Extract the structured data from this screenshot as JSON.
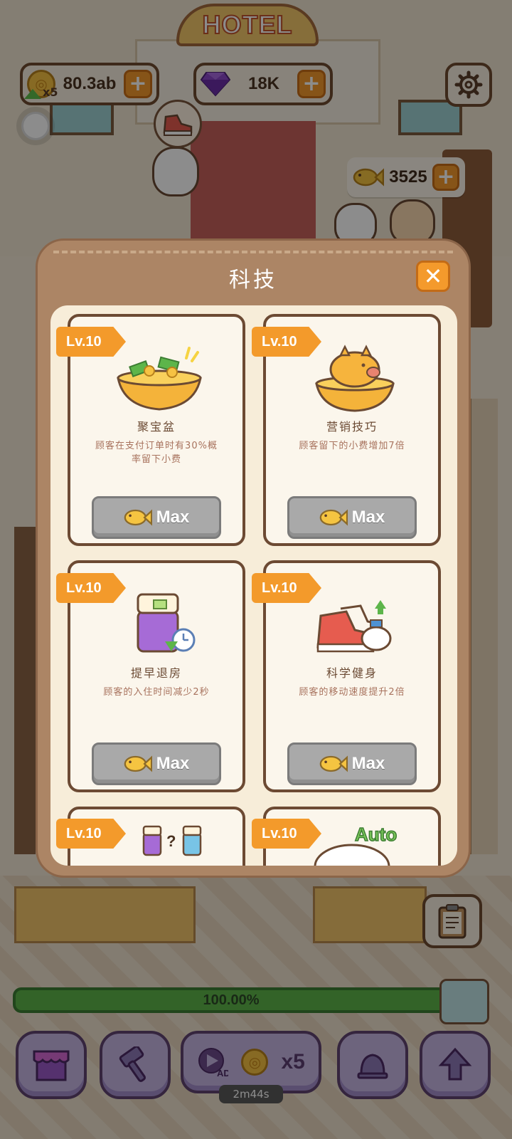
{
  "scene": {
    "sign_text": "HOTEL"
  },
  "hud": {
    "coins": "80.3ab",
    "gems": "18K",
    "fish": "3525",
    "upgrade_multiplier": "x5"
  },
  "modal": {
    "title": "科技",
    "cards": [
      {
        "level": "Lv.10",
        "name": "聚宝盆",
        "desc": "顾客在支付订单时有30%概率留下小费",
        "button": "Max"
      },
      {
        "level": "Lv.10",
        "name": "营销技巧",
        "desc": "顾客留下的小费增加7倍",
        "button": "Max"
      },
      {
        "level": "Lv.10",
        "name": "提早退房",
        "desc": "顾客的入住时间减少2秒",
        "button": "Max"
      },
      {
        "level": "Lv.10",
        "name": "科学健身",
        "desc": "顾客的移动速度提升2倍",
        "button": "Max"
      },
      {
        "level": "Lv.10",
        "illus_text": "?"
      },
      {
        "level": "Lv.10",
        "illus_text": "Auto"
      }
    ]
  },
  "bottom": {
    "progress": "100.00%",
    "progress_value": 1.0,
    "ad_label": "AD",
    "ad_multiplier": "x5",
    "timer": "2m44s"
  },
  "colors": {
    "accent_orange": "#f39a2b",
    "max_gray": "#a9a9a9",
    "panel_brown": "#ac8565",
    "progress_green": "#5db54a",
    "button_purple": "#c7b6e4"
  }
}
